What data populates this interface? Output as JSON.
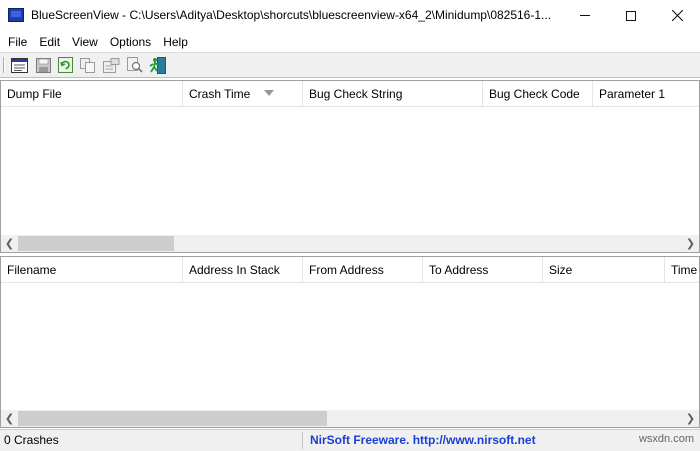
{
  "window": {
    "title": "BlueScreenView  -  C:\\Users\\Aditya\\Desktop\\shorcuts\\bluescreenview-x64_2\\Minidump\\082516-1...",
    "icon": "bluescreen-app-icon"
  },
  "menu": {
    "items": [
      {
        "label": "File"
      },
      {
        "label": "Edit"
      },
      {
        "label": "View"
      },
      {
        "label": "Options"
      },
      {
        "label": "Help"
      }
    ]
  },
  "toolbar": {
    "buttons": [
      {
        "icon": "properties-window-icon"
      },
      {
        "icon": "save-icon"
      },
      {
        "icon": "refresh-icon"
      },
      {
        "icon": "copy-icon"
      },
      {
        "icon": "properties-icon"
      },
      {
        "icon": "find-icon"
      },
      {
        "icon": "exit-icon"
      }
    ]
  },
  "crash_list": {
    "columns": [
      {
        "label": "Dump File"
      },
      {
        "label": "Crash Time"
      },
      {
        "label": "Bug Check String"
      },
      {
        "label": "Bug Check Code"
      },
      {
        "label": "Parameter 1"
      }
    ],
    "sorted_by": "Crash Time",
    "rows": []
  },
  "driver_list": {
    "columns": [
      {
        "label": "Filename"
      },
      {
        "label": "Address In Stack"
      },
      {
        "label": "From Address"
      },
      {
        "label": "To Address"
      },
      {
        "label": "Size"
      },
      {
        "label": "Time"
      }
    ],
    "rows": []
  },
  "status": {
    "count": "0 Crashes",
    "link": "NirSoft Freeware.  http://www.nirsoft.net"
  },
  "watermark": "wsxdn.com",
  "colors": {
    "link": "#1a3fd6",
    "toolbar_bg": "#f0f0f0"
  }
}
